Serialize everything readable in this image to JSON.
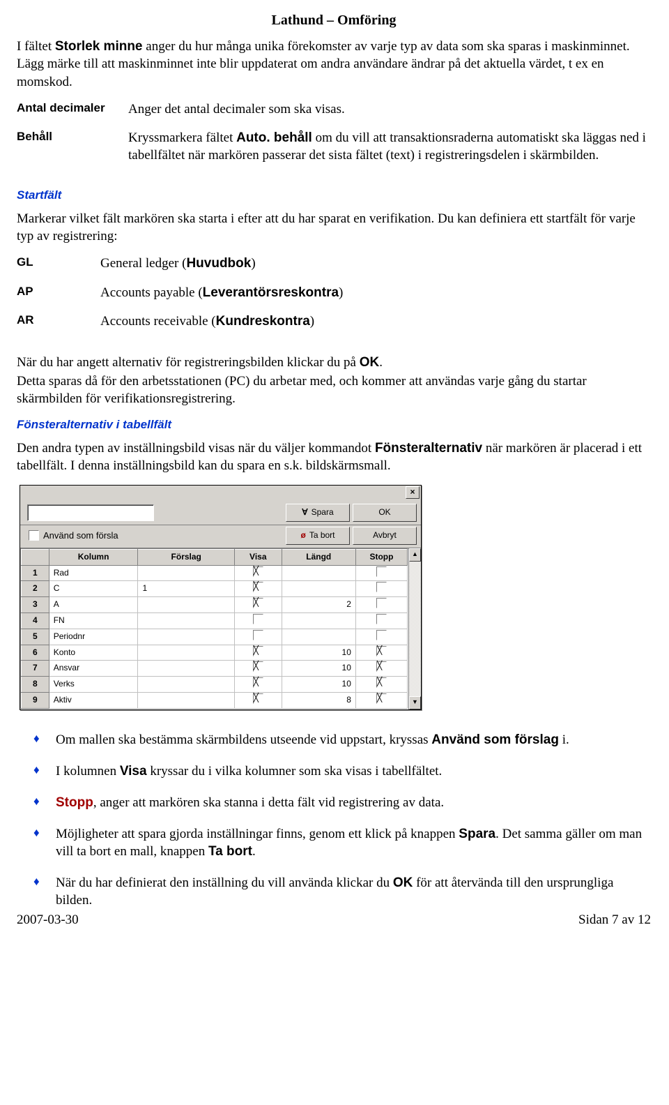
{
  "title": "Lathund – Omföring",
  "intro": {
    "p1a": "I fältet ",
    "p1b": "Storlek minne",
    "p1c": " anger du hur många unika förekomster av varje typ av data som ska sparas i maskinminnet. Lägg märke till att maskinminnet inte blir uppdaterat om andra användare ändrar på det aktuella värdet, t ex en momskod."
  },
  "defs": {
    "antal": {
      "term": "Antal decimaler",
      "val": "Anger det antal decimaler som ska visas."
    },
    "behall": {
      "term": "Behåll",
      "v1": "Kryssmarkera fältet ",
      "v2": "Auto. behåll",
      "v3": " om du vill att transaktionsraderna automatiskt ska läggas ned i tabellfältet när markören passerar det sista fältet (text) i registreringsdelen i skärmbilden."
    }
  },
  "startfalt": {
    "heading": "Startfält",
    "p1": "Markerar vilket fält markören ska starta i efter att du har sparat en verifikation. Du kan definiera ett startfält för varje typ av registrering:",
    "gl": {
      "term": "GL",
      "a": "General ledger (",
      "b": "Huvudbok",
      "c": ")"
    },
    "ap": {
      "term": "AP",
      "a": "Accounts payable (",
      "b": "Leverantörsreskontra",
      "c": ")"
    },
    "ar": {
      "term": "AR",
      "a": "Accounts receivable (",
      "b": "Kundreskontra",
      "c": ")"
    },
    "p2a": "När du har angett alternativ för registreringsbilden klickar du på ",
    "p2b": "OK",
    "p2c": ".",
    "p3": "Detta sparas då för den arbetsstationen (PC) du arbetar med, och kommer att användas varje gång du startar skärmbilden för verifikationsregistrering."
  },
  "fonster": {
    "heading": "Fönsteralternativ i tabellfält",
    "p1a": "Den andra typen av inställningsbild visas när du väljer kommandot ",
    "p1b": "Fönsteralternativ",
    "p1c": " när markören är placerad i ett tabellfält. I denna inställningsbild kan du spara en s.k. bildskärmsmall."
  },
  "dialog": {
    "spara": "Spara",
    "ok": "OK",
    "tabort": "Ta bort",
    "avbryt": "Avbryt",
    "anv_som_forslag": "Använd som försla",
    "headers": [
      "",
      "Kolumn",
      "Förslag",
      "Visa",
      "Längd",
      "Stopp"
    ],
    "rows": [
      {
        "n": "1",
        "kol": "Rad",
        "forslag": "",
        "visa": true,
        "langd": "",
        "stopp": false
      },
      {
        "n": "2",
        "kol": "C",
        "forslag": "1",
        "visa": true,
        "langd": "",
        "stopp": false
      },
      {
        "n": "3",
        "kol": "A",
        "forslag": "",
        "visa": true,
        "langd": "2",
        "stopp": false
      },
      {
        "n": "4",
        "kol": "FN",
        "forslag": "",
        "visa": false,
        "langd": "",
        "stopp": false
      },
      {
        "n": "5",
        "kol": "Periodnr",
        "forslag": "",
        "visa": false,
        "langd": "",
        "stopp": false
      },
      {
        "n": "6",
        "kol": "Konto",
        "forslag": "",
        "visa": true,
        "langd": "10",
        "stopp": true
      },
      {
        "n": "7",
        "kol": "Ansvar",
        "forslag": "",
        "visa": true,
        "langd": "10",
        "stopp": true
      },
      {
        "n": "8",
        "kol": "Verks",
        "forslag": "",
        "visa": true,
        "langd": "10",
        "stopp": true
      },
      {
        "n": "9",
        "kol": "Aktiv",
        "forslag": "",
        "visa": true,
        "langd": "8",
        "stopp": true
      }
    ]
  },
  "bullets": {
    "b1a": "Om mallen ska bestämma skärmbildens utseende vid uppstart, kryssas ",
    "b1b": "Använd som förslag",
    "b1c": " i.",
    "b2a": "I kolumnen ",
    "b2b": "Visa",
    "b2c": " kryssar du i vilka kolumner som ska visas i tabellfältet.",
    "b3a": "Stopp",
    "b3b": ", anger att markören ska stanna i detta fält vid registrering av data.",
    "b4a": "Möjligheter att spara gjorda inställningar finns, genom ett klick på knappen ",
    "b4b": "Spara",
    "b4c": ". Det samma gäller om man vill ta bort en mall, knappen ",
    "b4d": "Ta bort",
    "b4e": ".",
    "b5a": "När du har definierat den inställning du vill använda klickar du ",
    "b5b": "OK",
    "b5c": " för att återvända till den ursprungliga bilden."
  },
  "footer": {
    "left": "2007-03-30",
    "right": "Sidan 7 av 12"
  }
}
